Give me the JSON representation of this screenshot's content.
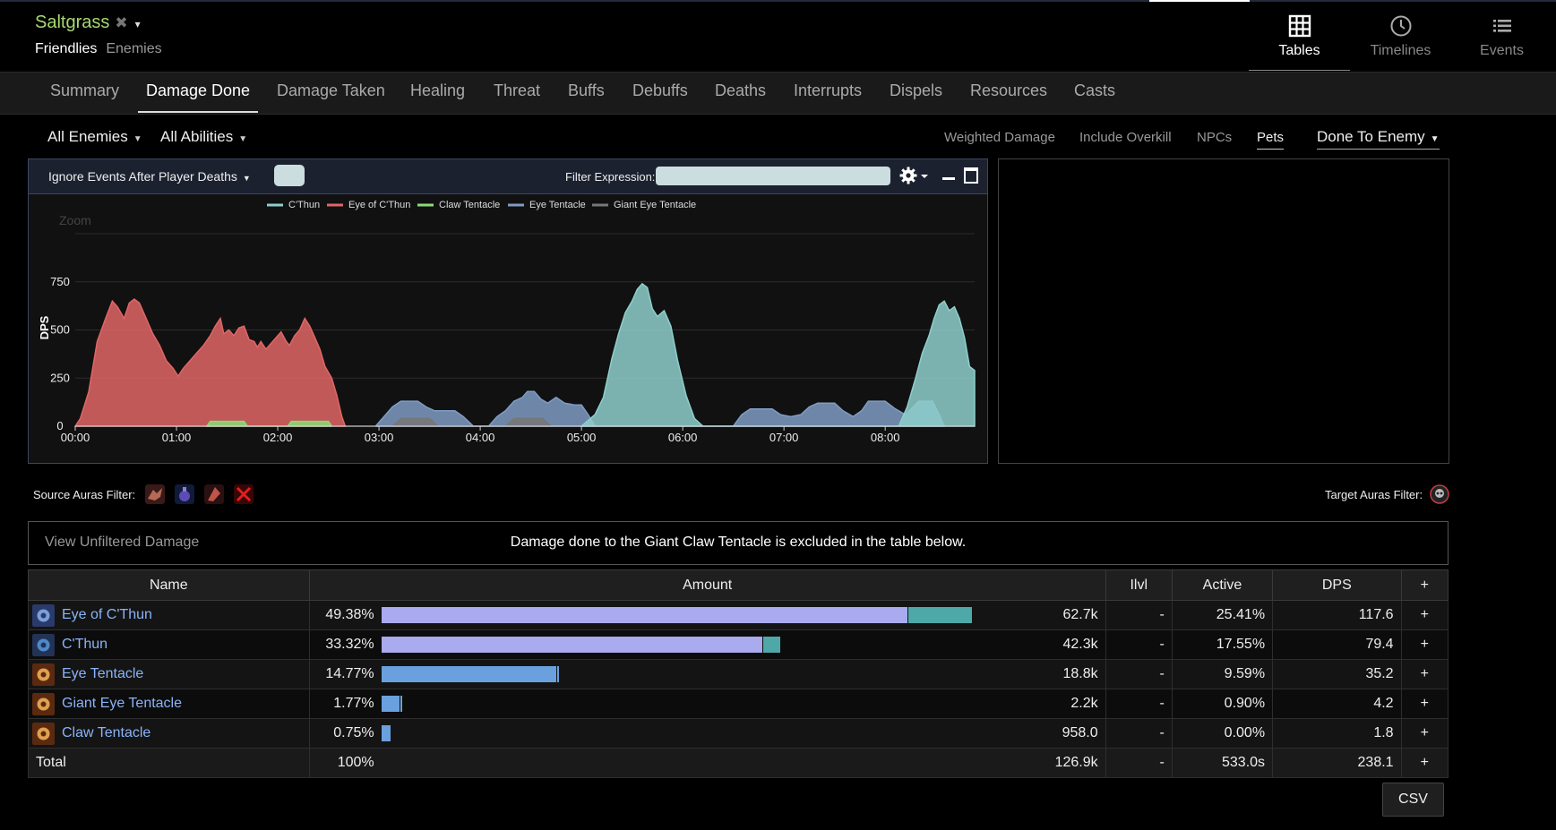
{
  "header": {
    "report_name": "Saltgrass",
    "close_glyph": "✖",
    "caret_glyph": "▾",
    "subnav": [
      "Friendlies",
      "Enemies"
    ]
  },
  "topnav": [
    {
      "label": "Tables",
      "icon": "grid-icon"
    },
    {
      "label": "Timelines",
      "icon": "clock-icon"
    },
    {
      "label": "Events",
      "icon": "list-icon"
    }
  ],
  "tabs": [
    "Summary",
    "Damage Done",
    "Damage Taken",
    "Healing",
    "Threat",
    "Buffs",
    "Debuffs",
    "Deaths",
    "Interrupts",
    "Dispels",
    "Resources",
    "Casts"
  ],
  "active_tab": "Damage Done",
  "filters": {
    "enemies": "All Enemies",
    "abilities": "All Abilities",
    "weighted": "Weighted Damage",
    "overkill": "Include Overkill",
    "npcs": "NPCs",
    "pets": "Pets",
    "done_to": "Done To Enemy"
  },
  "graph_toolbar": {
    "ignore_events": "Ignore Events After Player Deaths",
    "filter_label": "Filter Expression:"
  },
  "chart_data": {
    "type": "area",
    "ylabel": "DPS",
    "zoom_label": "Zoom",
    "y_ticks": [
      0,
      250,
      500,
      750
    ],
    "ylim": [
      0,
      1000
    ],
    "x_ticks": [
      "00:00",
      "01:00",
      "02:00",
      "03:00",
      "04:00",
      "05:00",
      "06:00",
      "07:00",
      "08:00"
    ],
    "xlim_seconds": [
      0,
      533
    ],
    "series": [
      {
        "name": "C'Thun",
        "color": "#8ecfcb",
        "points": [
          [
            300,
            0
          ],
          [
            308,
            60
          ],
          [
            313,
            150
          ],
          [
            318,
            350
          ],
          [
            322,
            480
          ],
          [
            326,
            590
          ],
          [
            330,
            650
          ],
          [
            333,
            710
          ],
          [
            336,
            740
          ],
          [
            339,
            720
          ],
          [
            342,
            610
          ],
          [
            345,
            570
          ],
          [
            349,
            600
          ],
          [
            353,
            520
          ],
          [
            357,
            340
          ],
          [
            362,
            160
          ],
          [
            367,
            40
          ],
          [
            372,
            0
          ],
          [
            488,
            0
          ],
          [
            493,
            100
          ],
          [
            498,
            250
          ],
          [
            502,
            380
          ],
          [
            506,
            470
          ],
          [
            509,
            560
          ],
          [
            512,
            630
          ],
          [
            515,
            650
          ],
          [
            518,
            600
          ],
          [
            521,
            620
          ],
          [
            524,
            560
          ],
          [
            527,
            460
          ],
          [
            530,
            310
          ],
          [
            533,
            290
          ]
        ]
      },
      {
        "name": "Eye of C'Thun",
        "color": "#e06666",
        "points": [
          [
            0,
            0
          ],
          [
            3,
            40
          ],
          [
            8,
            180
          ],
          [
            13,
            440
          ],
          [
            18,
            560
          ],
          [
            22,
            650
          ],
          [
            25,
            620
          ],
          [
            29,
            560
          ],
          [
            32,
            640
          ],
          [
            35,
            660
          ],
          [
            38,
            640
          ],
          [
            42,
            560
          ],
          [
            46,
            480
          ],
          [
            50,
            420
          ],
          [
            54,
            340
          ],
          [
            58,
            300
          ],
          [
            61,
            260
          ],
          [
            64,
            300
          ],
          [
            68,
            340
          ],
          [
            72,
            380
          ],
          [
            76,
            420
          ],
          [
            80,
            470
          ],
          [
            83,
            520
          ],
          [
            86,
            560
          ],
          [
            88,
            480
          ],
          [
            91,
            500
          ],
          [
            94,
            470
          ],
          [
            97,
            510
          ],
          [
            100,
            520
          ],
          [
            103,
            450
          ],
          [
            106,
            440
          ],
          [
            108,
            410
          ],
          [
            110,
            440
          ],
          [
            113,
            400
          ],
          [
            116,
            430
          ],
          [
            119,
            460
          ],
          [
            122,
            490
          ],
          [
            125,
            440
          ],
          [
            127,
            420
          ],
          [
            130,
            470
          ],
          [
            133,
            500
          ],
          [
            136,
            560
          ],
          [
            139,
            520
          ],
          [
            142,
            460
          ],
          [
            145,
            400
          ],
          [
            148,
            310
          ],
          [
            152,
            250
          ],
          [
            155,
            160
          ],
          [
            158,
            50
          ],
          [
            160,
            0
          ]
        ]
      },
      {
        "name": "Claw Tentacle",
        "color": "#88dd77",
        "points": [
          [
            78,
            0
          ],
          [
            80,
            25
          ],
          [
            100,
            25
          ],
          [
            102,
            0
          ],
          [
            126,
            0
          ],
          [
            128,
            25
          ],
          [
            150,
            25
          ],
          [
            152,
            0
          ]
        ]
      },
      {
        "name": "Eye Tentacle",
        "color": "#7f9cc4",
        "points": [
          [
            178,
            0
          ],
          [
            183,
            50
          ],
          [
            188,
            100
          ],
          [
            193,
            130
          ],
          [
            203,
            130
          ],
          [
            208,
            100
          ],
          [
            213,
            80
          ],
          [
            225,
            80
          ],
          [
            230,
            50
          ],
          [
            236,
            0
          ],
          [
            245,
            0
          ],
          [
            250,
            50
          ],
          [
            255,
            80
          ],
          [
            260,
            130
          ],
          [
            265,
            150
          ],
          [
            268,
            180
          ],
          [
            272,
            180
          ],
          [
            276,
            140
          ],
          [
            280,
            120
          ],
          [
            285,
            150
          ],
          [
            290,
            120
          ],
          [
            296,
            110
          ],
          [
            300,
            110
          ],
          [
            304,
            60
          ],
          [
            308,
            0
          ],
          [
            390,
            0
          ],
          [
            395,
            60
          ],
          [
            400,
            90
          ],
          [
            413,
            90
          ],
          [
            418,
            60
          ],
          [
            424,
            50
          ],
          [
            430,
            60
          ],
          [
            435,
            100
          ],
          [
            440,
            120
          ],
          [
            450,
            120
          ],
          [
            455,
            80
          ],
          [
            461,
            50
          ],
          [
            466,
            80
          ],
          [
            470,
            130
          ],
          [
            480,
            130
          ],
          [
            486,
            90
          ],
          [
            492,
            60
          ],
          [
            500,
            130
          ],
          [
            508,
            130
          ],
          [
            512,
            60
          ],
          [
            515,
            0
          ]
        ]
      },
      {
        "name": "Giant Eye Tentacle",
        "color": "#777777",
        "points": [
          [
            188,
            0
          ],
          [
            193,
            40
          ],
          [
            210,
            40
          ],
          [
            215,
            0
          ],
          [
            255,
            0
          ],
          [
            260,
            40
          ],
          [
            277,
            40
          ],
          [
            282,
            0
          ]
        ]
      }
    ]
  },
  "auras": {
    "source_label": "Source Auras Filter:",
    "target_label": "Target Auras Filter:",
    "source_icons": [
      "dragon-aura-icon",
      "potion-aura-icon",
      "bloodfang-aura-icon",
      "red-rune-aura-icon"
    ],
    "target_icons": [
      "skull-aura-icon"
    ]
  },
  "notice": {
    "link": "View Unfiltered Damage",
    "message": "Damage done to the Giant Claw Tentacle is excluded in the table below."
  },
  "table": {
    "headers": {
      "name": "Name",
      "amount": "Amount",
      "ilvl": "Ilvl",
      "active": "Active",
      "dps": "DPS",
      "plus": "+"
    },
    "rows": [
      {
        "name": "Eye of C'Thun",
        "percent": "49.38%",
        "share": 49.38,
        "amount": "62.7k",
        "ilvl": "-",
        "active": "25.41%",
        "dps": "117.6",
        "icon": "eye-of-cthun-icon",
        "seg1": 0.7836,
        "seg2": 0.094,
        "seg1_color": "#aaaaee",
        "seg2_color": "#4fa8a8"
      },
      {
        "name": "C'Thun",
        "percent": "33.32%",
        "share": 33.32,
        "amount": "42.3k",
        "ilvl": "-",
        "active": "17.55%",
        "dps": "79.4",
        "icon": "cthun-icon",
        "seg1": 0.5669,
        "seg2": 0.0256,
        "seg1_color": "#aaaaee",
        "seg2_color": "#4fa8a8"
      },
      {
        "name": "Eye Tentacle",
        "percent": "14.77%",
        "share": 14.77,
        "amount": "18.8k",
        "ilvl": "-",
        "active": "9.59%",
        "dps": "35.2",
        "icon": "eye-tentacle-icon",
        "seg1": 0.2599,
        "seg2": 0.0027,
        "seg1_color": "#6aa0dd",
        "seg2_color": "#6aa0dd"
      },
      {
        "name": "Giant Eye Tentacle",
        "percent": "1.77%",
        "share": 1.77,
        "amount": "2.2k",
        "ilvl": "-",
        "active": "0.90%",
        "dps": "4.2",
        "icon": "giant-eye-tentacle-icon",
        "seg1": 0.0266,
        "seg2": 0.0027,
        "seg1_color": "#6aa0dd",
        "seg2_color": "#6aa0dd"
      },
      {
        "name": "Claw Tentacle",
        "percent": "0.75%",
        "share": 0.75,
        "amount": "958.0",
        "ilvl": "-",
        "active": "0.00%",
        "dps": "1.8",
        "icon": "claw-tentacle-icon",
        "seg1": 0.0133,
        "seg2": 0,
        "seg1_color": "#6aa0dd",
        "seg2_color": "#6aa0dd"
      }
    ],
    "total": {
      "label": "Total",
      "percent": "100%",
      "amount": "126.9k",
      "ilvl": "-",
      "active": "533.0s",
      "dps": "238.1"
    }
  },
  "csv_label": "CSV",
  "colors": {
    "accent_green": "#a7d870",
    "name_blue": "#8ab4f8",
    "dps_green": "#c7e070",
    "background": "#000000"
  }
}
